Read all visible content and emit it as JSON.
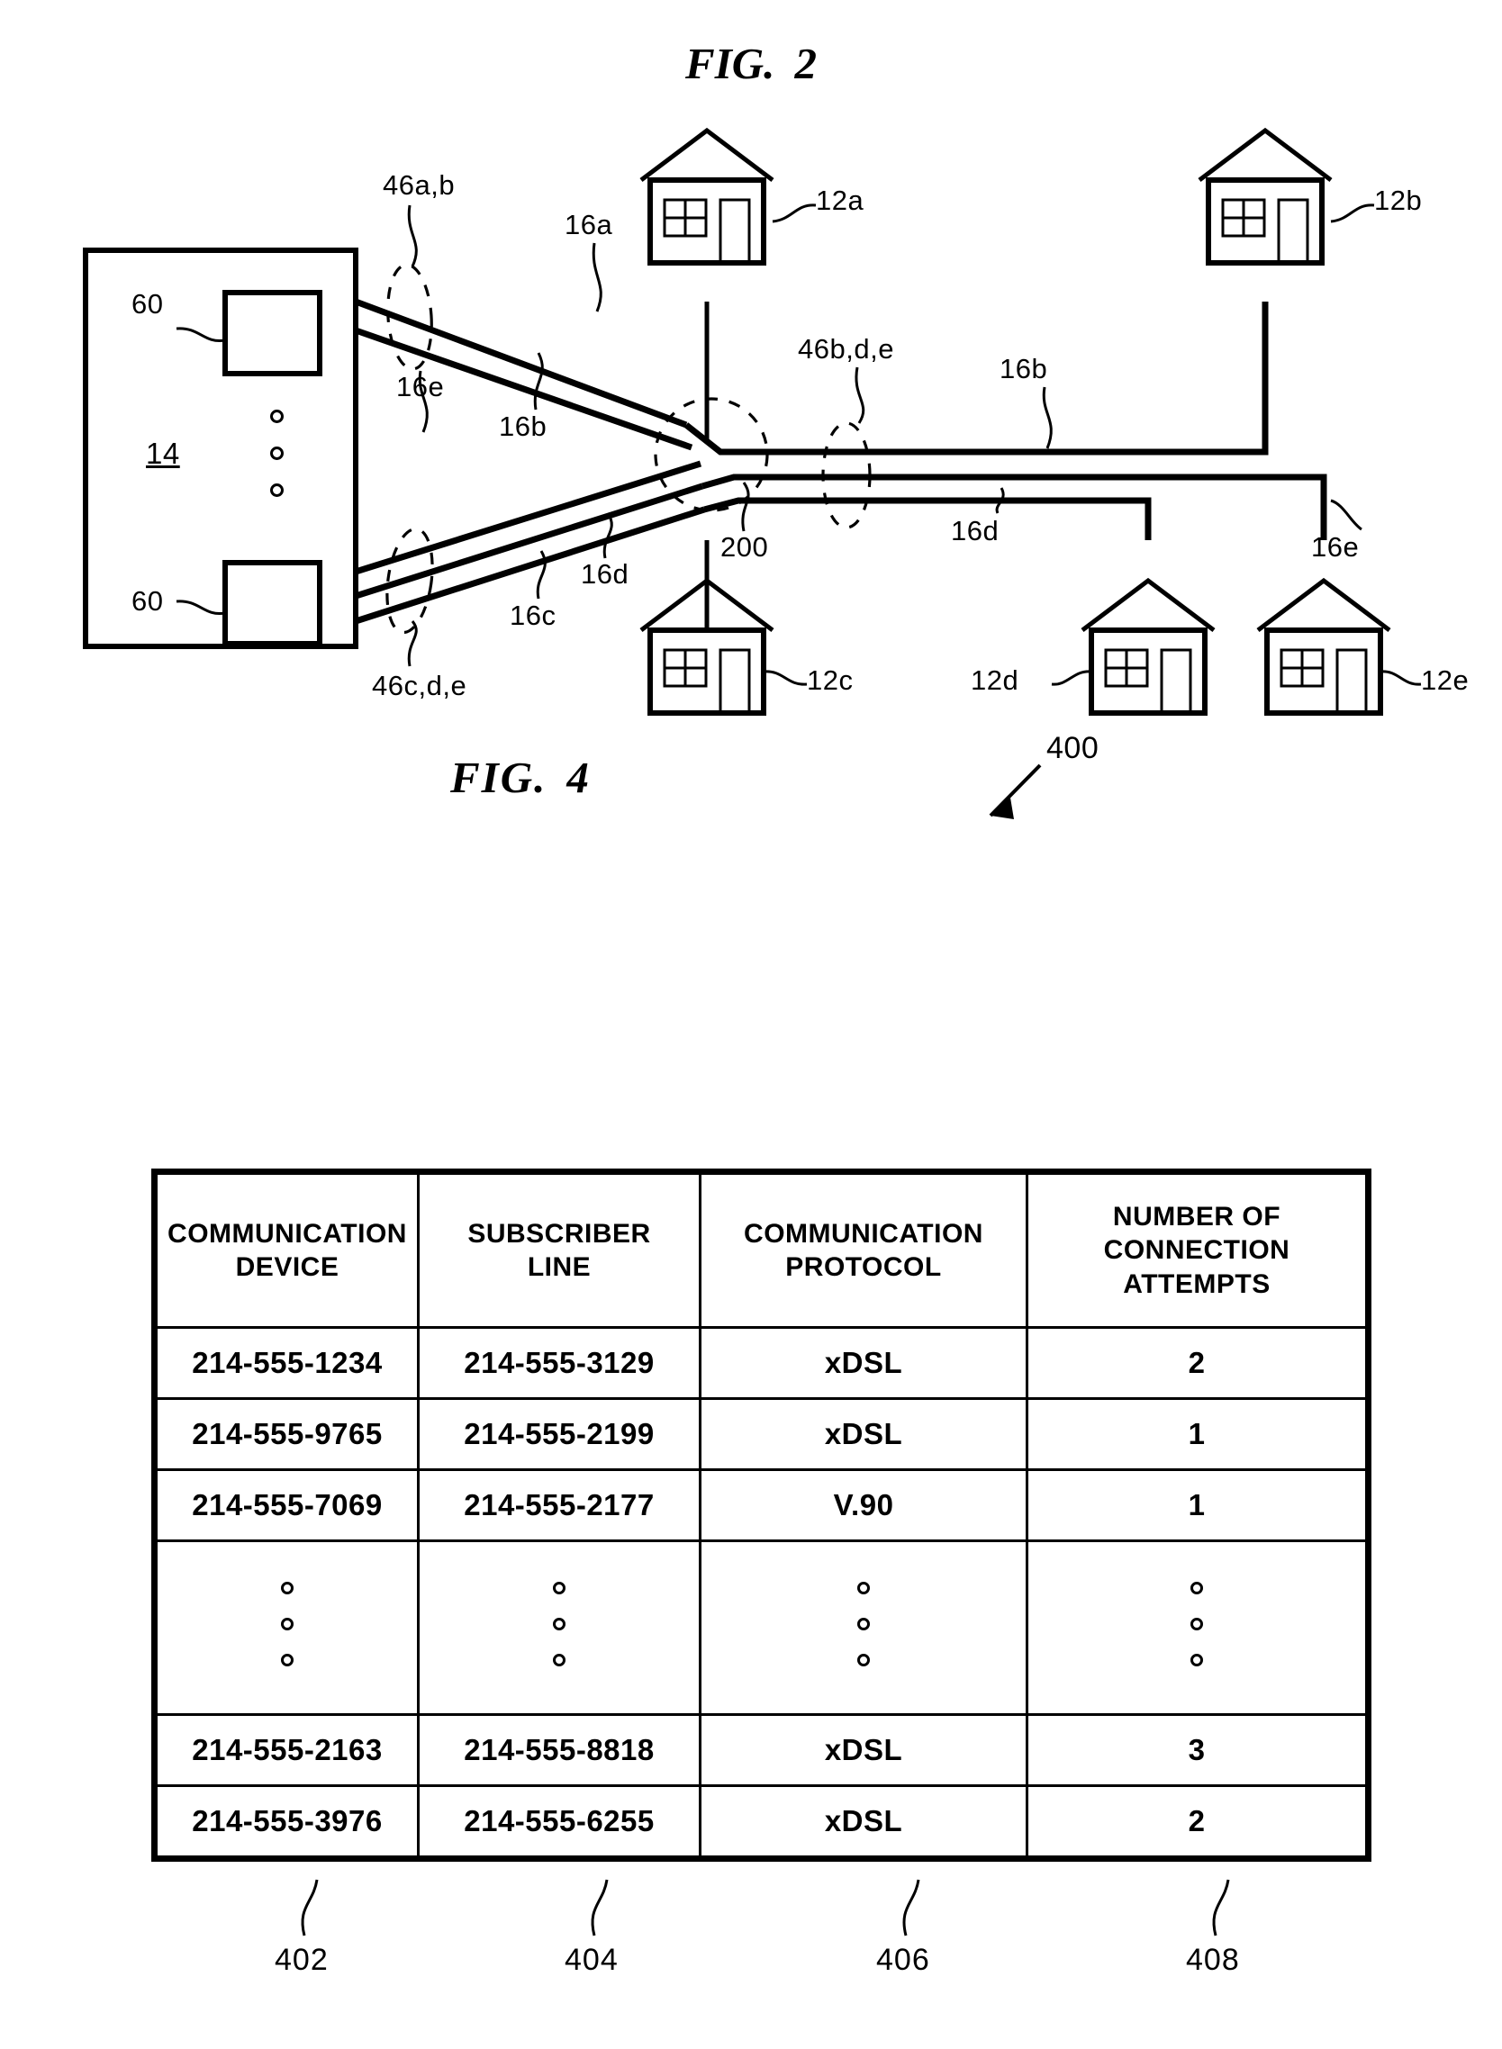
{
  "figures": {
    "fig2": {
      "title_main": "FIG.",
      "title_number": "2",
      "central_office": {
        "label": "14",
        "port_top_label": "60",
        "port_bottom_label": "60"
      },
      "labels": {
        "bundle_top": "46a,b",
        "bundle_bottom": "46c,d,e",
        "bundle_mid": "46b,d,e",
        "line_16a": "16a",
        "line_16b_left": "16b",
        "line_16b_right": "16b",
        "line_16c": "16c",
        "line_16d_left": "16d",
        "line_16d_right": "16d",
        "line_16e_left": "16e",
        "line_16e_right": "16e",
        "node_200": "200"
      },
      "premises": [
        {
          "id": "12a",
          "label": "12a"
        },
        {
          "id": "12b",
          "label": "12b"
        },
        {
          "id": "12c",
          "label": "12c"
        },
        {
          "id": "12d",
          "label": "12d"
        },
        {
          "id": "12e",
          "label": "12e"
        }
      ]
    },
    "fig4": {
      "title_main": "FIG.",
      "title_number": "4",
      "table_ref": "400",
      "columns": [
        {
          "header": "COMMUNICATION\nDEVICE",
          "header_line1": "COMMUNICATION",
          "header_line2": "DEVICE",
          "ref": "402"
        },
        {
          "header": "SUBSCRIBER\nLINE",
          "header_line1": "SUBSCRIBER",
          "header_line2": "LINE",
          "ref": "404"
        },
        {
          "header": "COMMUNICATION\nPROTOCOL",
          "header_line1": "COMMUNICATION",
          "header_line2": "PROTOCOL",
          "ref": "406"
        },
        {
          "header": "NUMBER OF\nCONNECTION\nATTEMPTS",
          "header_line1": "NUMBER OF",
          "header_line2": "CONNECTION",
          "header_line3": "ATTEMPTS",
          "ref": "408"
        }
      ],
      "rows": [
        {
          "device": "214-555-1234",
          "line": "214-555-3129",
          "protocol": "xDSL",
          "attempts": "2"
        },
        {
          "device": "214-555-9765",
          "line": "214-555-2199",
          "protocol": "xDSL",
          "attempts": "1"
        },
        {
          "device": "214-555-7069",
          "line": "214-555-2177",
          "protocol": "V.90",
          "attempts": "1"
        },
        {
          "device": "",
          "line": "",
          "protocol": "",
          "attempts": "",
          "ellipsis": true
        },
        {
          "device": "214-555-2163",
          "line": "214-555-8818",
          "protocol": "xDSL",
          "attempts": "3"
        },
        {
          "device": "214-555-3976",
          "line": "214-555-6255",
          "protocol": "xDSL",
          "attempts": "2"
        }
      ]
    }
  },
  "colors": {
    "ink": "#000000",
    "paper": "#ffffff"
  }
}
